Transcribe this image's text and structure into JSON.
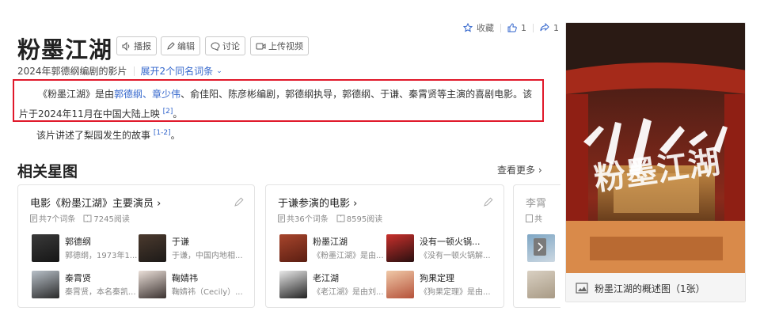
{
  "header": {
    "title": "粉墨江湖",
    "buttons": [
      "播报",
      "编辑",
      "讨论",
      "上传视频"
    ],
    "subtitle": "2024年郭德纲编剧的影片",
    "expand_link": "展开2个同名词条",
    "collect_label": "收藏",
    "like_count": "1",
    "share_count": "1"
  },
  "summary": {
    "p1": "《粉墨江湖》是由",
    "link1": "郭德纲",
    "sep1": "、",
    "link2": "章少伟",
    "p2": "、俞佳阳、陈彦彬编剧，郭德纲执导，郭德纲、于谦、秦霄贤等主演的喜剧电影。该片于2024年11月在中国大陆上映",
    "ref": "[2]",
    "end": "。"
  },
  "description": {
    "text": "该片讲述了梨园发生的故事",
    "ref": "[1-2]",
    "end": "。"
  },
  "stars": {
    "title": "相关星图",
    "more": "查看更多",
    "cards": [
      {
        "title": "电影《粉墨江湖》主要演员",
        "count": "共7个词条",
        "reads": "7245阅读",
        "entries": [
          {
            "name": "郭德纲",
            "desc": "郭德纲，1973年1..."
          },
          {
            "name": "于谦",
            "desc": "于谦，中国内地相..."
          },
          {
            "name": "秦霄贤",
            "desc": "秦霄贤，本名秦凯..."
          },
          {
            "name": "鞠婧祎",
            "desc": "鞠婧祎（Cecily）..."
          }
        ]
      },
      {
        "title": "于谦参演的电影",
        "count": "共36个词条",
        "reads": "8595阅读",
        "entries": [
          {
            "name": "粉墨江湖",
            "desc": "《粉墨江湖》是由..."
          },
          {
            "name": "没有一顿火锅...",
            "desc": "《没有一顿火锅解..."
          },
          {
            "name": "老江湖",
            "desc": "《老江湖》是由刘..."
          },
          {
            "name": "狗果定理",
            "desc": "《狗果定理》是由..."
          }
        ]
      },
      {
        "title": "李霄",
        "count": "共"
      }
    ]
  },
  "poster": {
    "art_text": "粉墨江湖",
    "caption": "粉墨江湖的概述图（1张）"
  },
  "colors": {
    "link": "#3366cc",
    "highlight_border": "#e0182a"
  }
}
